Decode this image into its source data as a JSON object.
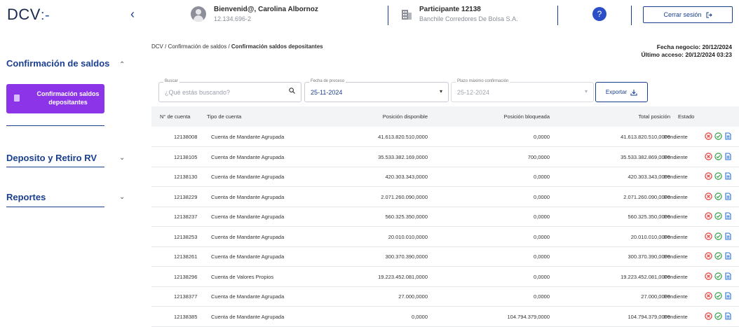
{
  "header": {
    "logo": "DCV",
    "logo_mark": ":-",
    "user_name": "Bienvenid@, Carolina Albornoz",
    "user_rut": "12.134.696-2",
    "participant_name": "Participante 12138",
    "participant_org": "Banchile Corredores De Bolsa S.A.",
    "logout_label": "Cerrar sesión",
    "help_label": "?"
  },
  "sidebar": {
    "section1_title": "Confirmación de saldos",
    "active_item": "Confirmación saldos depositantes",
    "section2_title": "Deposito y Retiro RV",
    "section3_title": "Reportes"
  },
  "breadcrumb": {
    "root": "DCV",
    "sep": "/",
    "level1": "Confirmación de saldos",
    "current": "Confirmación saldos depositantes"
  },
  "dates": {
    "fecha_negocio": "Fecha negocio: 20/12/2024",
    "ultimo_acceso": "Último acceso: 20/12/2024 03:23"
  },
  "filters": {
    "search_label": "Buscar",
    "search_placeholder": "¿Qué estás buscando?",
    "proceso_label": "Fecha de proceso",
    "proceso_value": "25-11-2024",
    "plazo_label": "Plazo máximo confirmación",
    "plazo_value": "25-12-2024",
    "export_label": "Exportar"
  },
  "table": {
    "headers": {
      "cuenta": "N° de cuenta",
      "tipo": "Tipo de cuenta",
      "disponible": "Posición disponible",
      "bloqueada": "Posición bloqueada",
      "total": "Total posición",
      "estado": "Estado"
    },
    "rows": [
      {
        "cuenta": "12138008",
        "tipo": "Cuenta de Mandante Agrupada",
        "disponible": "41.613.820.510,0000",
        "bloqueada": "0,0000",
        "total": "41.613.820.510,0000",
        "estado": "Pendiente"
      },
      {
        "cuenta": "12138105",
        "tipo": "Cuenta de Mandante Agrupada",
        "disponible": "35.533.382.169,0000",
        "bloqueada": "700,0000",
        "total": "35.533.382.869,0000",
        "estado": "Pendiente"
      },
      {
        "cuenta": "12138130",
        "tipo": "Cuenta de Mandante Agrupada",
        "disponible": "420.303.343,0000",
        "bloqueada": "0,0000",
        "total": "420.303.343,0000",
        "estado": "Pendiente"
      },
      {
        "cuenta": "12138229",
        "tipo": "Cuenta de Mandante Agrupada",
        "disponible": "2.071.260.090,0000",
        "bloqueada": "0,0000",
        "total": "2.071.260.090,0000",
        "estado": "Pendiente"
      },
      {
        "cuenta": "12138237",
        "tipo": "Cuenta de Mandante Agrupada",
        "disponible": "560.325.350,0000",
        "bloqueada": "0,0000",
        "total": "560.325.350,0000",
        "estado": "Pendiente"
      },
      {
        "cuenta": "12138253",
        "tipo": "Cuenta de Mandante Agrupada",
        "disponible": "20.010.010,0000",
        "bloqueada": "0,0000",
        "total": "20.010.010,0000",
        "estado": "Pendiente"
      },
      {
        "cuenta": "12138261",
        "tipo": "Cuenta de Mandante Agrupada",
        "disponible": "300.370.390,0000",
        "bloqueada": "0,0000",
        "total": "300.370.390,0000",
        "estado": "Pendiente"
      },
      {
        "cuenta": "12138296",
        "tipo": "Cuenta de Valores Propios",
        "disponible": "19.223.452.081,0000",
        "bloqueada": "0,0000",
        "total": "19.223.452.081,0000",
        "estado": "Pendiente"
      },
      {
        "cuenta": "12138377",
        "tipo": "Cuenta de Mandante Agrupada",
        "disponible": "27.000,0000",
        "bloqueada": "0,0000",
        "total": "27.000,0000",
        "estado": "Pendiente"
      },
      {
        "cuenta": "12138385",
        "tipo": "Cuenta de Mandante Agrupada",
        "disponible": "0,0000",
        "bloqueada": "104.794.379,0000",
        "total": "104.794.379,0000",
        "estado": "Pendiente"
      }
    ]
  },
  "colors": {
    "brand": "#1a3f8f",
    "active_item": "#8c35e8",
    "reject": "#e53935",
    "approve": "#2e9e44",
    "document": "#2b6fd6"
  },
  "icons": {
    "reject": "x-circle-icon",
    "approve": "check-circle-icon",
    "document": "document-icon"
  }
}
